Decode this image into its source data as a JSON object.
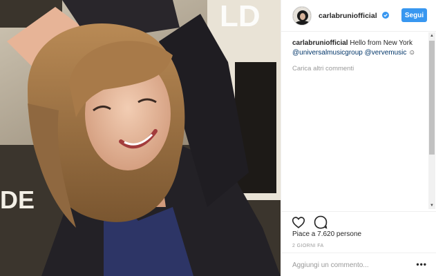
{
  "post": {
    "photo_alt": "post-photo",
    "author": {
      "username": "carlabruniofficial",
      "verified": true,
      "follow_label": "Segui"
    },
    "caption": {
      "author": "carlabruniofficial",
      "text": "Hello from New York",
      "mention1": "@universalmusicgroup",
      "mention2": "@vervemusic",
      "emoji": "☺"
    },
    "load_more_comments": "Carica altri commenti",
    "likes_text": "Piace a 7.620 persone",
    "date_text": "2 GIORNI FA",
    "comment_placeholder": "Aggiungi un commento...",
    "more_options": "•••"
  },
  "colors": {
    "accent": "#3897f0",
    "link": "#003569",
    "muted": "#999999"
  },
  "icons": {
    "like": "heart-outline-icon",
    "comment": "speech-bubble-icon",
    "verified": "verified-badge-icon",
    "more": "more-options-icon"
  }
}
